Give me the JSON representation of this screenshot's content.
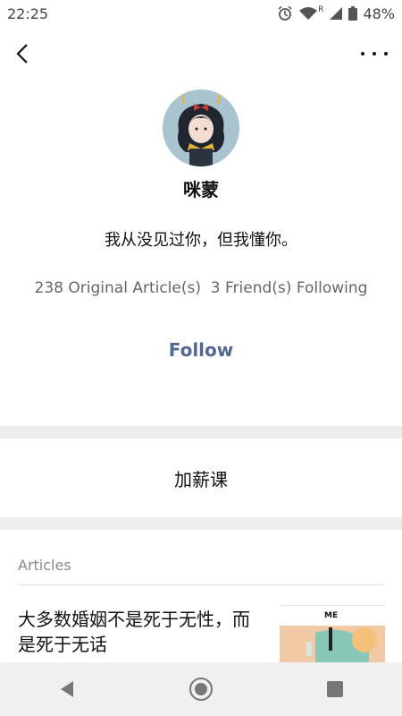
{
  "status_bar": {
    "time": "22:25",
    "network": "R",
    "battery": "48%",
    "icons": [
      "alarm-icon",
      "wifi-icon",
      "signal-icon",
      "battery-icon"
    ]
  },
  "profile": {
    "name": "咪蒙",
    "bio": "我从没见过你，但我懂你。",
    "stats": "238 Original Article(s)  3 Friend(s) Following",
    "follow_label": "Follow"
  },
  "section": {
    "label": "加薪课"
  },
  "articles": {
    "header": "Articles",
    "items": [
      {
        "title": "大多数婚姻不是死于无性，而是死于无话",
        "thumb_text": "ME"
      }
    ]
  },
  "colors": {
    "accent": "#56688f",
    "divider": "#ededed",
    "muted": "#8a8a8a"
  },
  "nav": {
    "icons": [
      "back-triangle-icon",
      "home-circle-icon",
      "recents-square-icon"
    ]
  }
}
